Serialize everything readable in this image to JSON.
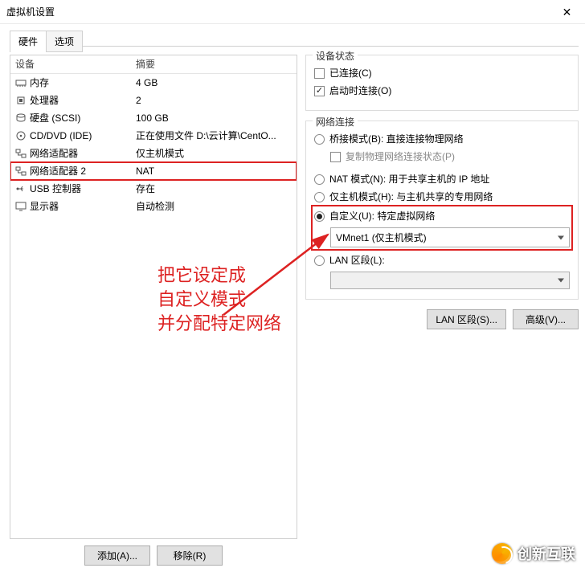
{
  "window": {
    "title": "虚拟机设置"
  },
  "tabs": {
    "hardware": "硬件",
    "options": "选项"
  },
  "list": {
    "header_device": "设备",
    "header_summary": "摘要",
    "rows": [
      {
        "device": "内存",
        "summary": "4 GB"
      },
      {
        "device": "处理器",
        "summary": "2"
      },
      {
        "device": "硬盘 (SCSI)",
        "summary": "100 GB"
      },
      {
        "device": "CD/DVD (IDE)",
        "summary": "正在使用文件 D:\\云计算\\CentO..."
      },
      {
        "device": "网络适配器",
        "summary": "仅主机模式"
      },
      {
        "device": "网络适配器 2",
        "summary": "NAT",
        "highlight": true
      },
      {
        "device": "USB 控制器",
        "summary": "存在"
      },
      {
        "device": "显示器",
        "summary": "自动检测"
      }
    ]
  },
  "buttons": {
    "add": "添加(A)...",
    "remove": "移除(R)"
  },
  "status_group": {
    "legend": "设备状态",
    "connected": "已连接(C)",
    "connect_on_power": "启动时连接(O)"
  },
  "net_group": {
    "legend": "网络连接",
    "bridged": "桥接模式(B): 直接连接物理网络",
    "replicate": "复制物理网络连接状态(P)",
    "nat": "NAT 模式(N): 用于共享主机的 IP 地址",
    "hostonly": "仅主机模式(H): 与主机共享的专用网络",
    "custom": "自定义(U): 特定虚拟网络",
    "custom_select": "VMnet1 (仅主机模式)",
    "lan_seg": "LAN 区段(L):"
  },
  "right_buttons": {
    "lan": "LAN 区段(S)...",
    "advanced": "高级(V)..."
  },
  "annotation": {
    "l1": "把它设定成",
    "l2": "自定义模式",
    "l3": "并分配特定网络"
  },
  "watermark": "创新互联"
}
